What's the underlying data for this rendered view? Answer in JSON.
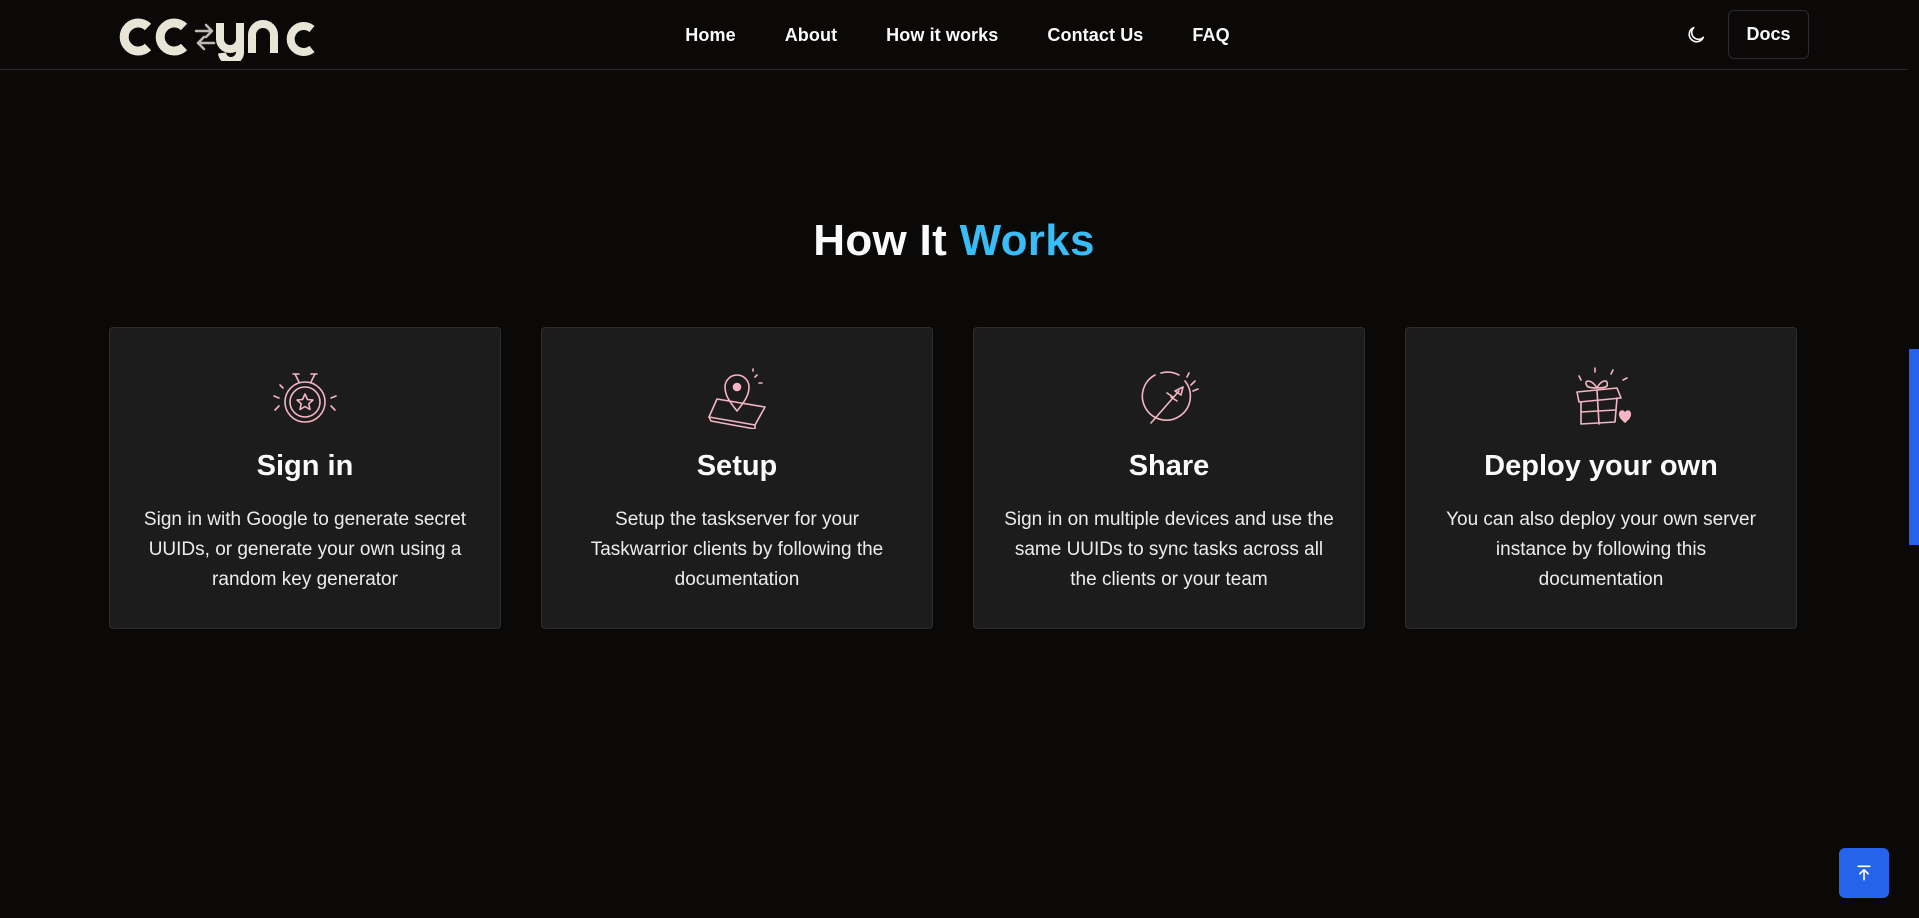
{
  "header": {
    "logo_text": "ccsync",
    "nav": [
      {
        "label": "Home"
      },
      {
        "label": "About"
      },
      {
        "label": "How it works"
      },
      {
        "label": "Contact Us"
      },
      {
        "label": "FAQ"
      }
    ],
    "docs_label": "Docs",
    "theme_icon": "moon-icon"
  },
  "section": {
    "title_main": "How It",
    "title_accent": "Works",
    "accent_color": "#38bdf8"
  },
  "cards": [
    {
      "icon": "stopwatch-star-icon",
      "title": "Sign in",
      "text": "Sign in with Google to generate secret UUIDs, or generate your own using a random key generator"
    },
    {
      "icon": "map-pin-icon",
      "title": "Setup",
      "text": "Setup the taskserver for your Taskwarrior clients by following the documentation"
    },
    {
      "icon": "rocket-planet-icon",
      "title": "Share",
      "text": "Sign in on multiple devices and use the same UUIDs to sync tasks across all the clients or your team"
    },
    {
      "icon": "gift-box-icon",
      "title": "Deploy your own",
      "text": "You can also deploy your own server instance by following this documentation"
    }
  ],
  "colors": {
    "background": "#0a0908",
    "card": "#1c1c1c",
    "icon_stroke": "#f5b5c5",
    "button_blue": "#2563eb"
  }
}
